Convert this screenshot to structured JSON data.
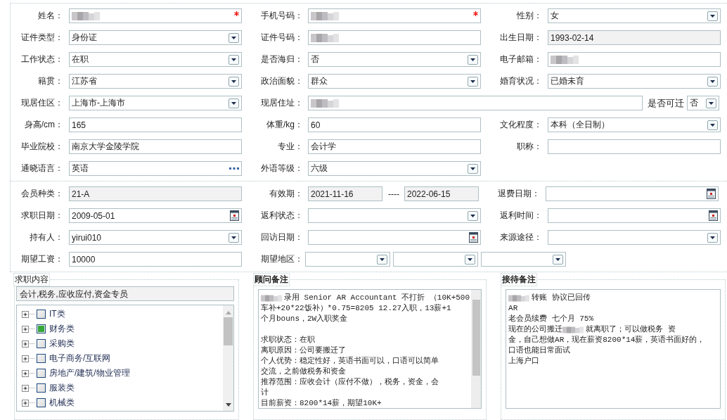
{
  "sections": [
    {
      "rows": [
        {
          "cells": [
            {
              "label": "姓名：",
              "kind": "text",
              "redacted": true,
              "required": true
            },
            {
              "label": "手机号码：",
              "kind": "text",
              "redacted": true,
              "required": true
            },
            {
              "label": "性别：",
              "kind": "select",
              "value": "女"
            }
          ]
        },
        {
          "cells": [
            {
              "label": "证件类型：",
              "kind": "select",
              "value": "身份证"
            },
            {
              "label": "证件号码：",
              "kind": "text",
              "redacted": true
            },
            {
              "label": "出生日期：",
              "kind": "text",
              "value": "1993-02-14",
              "disabled": true
            }
          ]
        },
        {
          "cells": [
            {
              "label": "工作状态：",
              "kind": "select",
              "value": "在职"
            },
            {
              "label": "是否海归：",
              "kind": "select",
              "value": "否"
            },
            {
              "label": "电子邮箱：",
              "kind": "text",
              "redacted": true
            }
          ]
        },
        {
          "cells": [
            {
              "label": "籍贯：",
              "kind": "select",
              "value": "江苏省"
            },
            {
              "label": "政治面貌：",
              "kind": "select",
              "value": "群众"
            },
            {
              "label": "婚育状况：",
              "kind": "select",
              "value": "已婚未育"
            }
          ]
        },
        {
          "cells": [
            {
              "label": "现居住区：",
              "kind": "select",
              "value": "上海市-上海市"
            },
            {
              "label": "现居住址：",
              "kind": "wide",
              "redacted": true,
              "extra": {
                "label": "是否可迁",
                "kind": "select",
                "value": "否"
              }
            }
          ]
        },
        {
          "cells": [
            {
              "label": "身高/cm：",
              "kind": "text",
              "value": "165"
            },
            {
              "label": "体重/kg：",
              "kind": "text",
              "value": "60"
            },
            {
              "label": "文化程度：",
              "kind": "select",
              "value": "本科（全日制）"
            }
          ]
        },
        {
          "cells": [
            {
              "label": "毕业院校：",
              "kind": "text",
              "value": "南京大学金陵学院"
            },
            {
              "label": "专业：",
              "kind": "text",
              "value": "会计学"
            },
            {
              "label": "职称：",
              "kind": "text"
            }
          ]
        },
        {
          "cells": [
            {
              "label": "通晓语言：",
              "kind": "lookup",
              "value": "英语"
            },
            {
              "label": "外语等级：",
              "kind": "select",
              "value": "六级"
            }
          ]
        }
      ]
    },
    {
      "rows": [
        {
          "cells": [
            {
              "label": "会员种类：",
              "kind": "text",
              "value": "21-A",
              "disabled": true
            },
            {
              "label": "有效期：",
              "kind": "range",
              "separator": "----",
              "parts": [
                {
                  "value": "2021-11-16",
                  "disabled": true
                },
                {
                  "value": "2022-06-15",
                  "disabled": true
                }
              ]
            },
            {
              "label": "退费日期：",
              "kind": "date"
            }
          ]
        },
        {
          "cells": [
            {
              "label": "求职日期：",
              "kind": "date",
              "value": "2009-05-01"
            },
            {
              "label": "返利状态：",
              "kind": "select"
            },
            {
              "label": "返利时间：",
              "kind": "date"
            }
          ]
        },
        {
          "cells": [
            {
              "label": "持有人：",
              "kind": "select",
              "value": "yirui010"
            },
            {
              "label": "回访日期：",
              "kind": "date"
            },
            {
              "label": "来源途径：",
              "kind": "select"
            }
          ]
        },
        {
          "cells": [
            {
              "label": "期望工资：",
              "kind": "text",
              "value": "10000"
            },
            {
              "label": "期望地区：",
              "kind": "multi",
              "parts": [
                {
                  "kind": "select"
                },
                {
                  "kind": "select"
                },
                {
                  "kind": "select"
                }
              ]
            }
          ]
        }
      ]
    }
  ],
  "panels": {
    "job": {
      "title": "求职内容",
      "summary": "会计,税务,应收应付,资金专员",
      "tree": [
        {
          "label": "IT类",
          "checked": false,
          "expanded": false
        },
        {
          "label": "财务类",
          "checked": true,
          "expanded": false
        },
        {
          "label": "采购类",
          "checked": false,
          "expanded": false
        },
        {
          "label": "电子商务/互联网",
          "checked": false,
          "expanded": false
        },
        {
          "label": "房地产/建筑/物业管理",
          "checked": false,
          "expanded": false
        },
        {
          "label": "服装类",
          "checked": false,
          "expanded": false
        },
        {
          "label": "机械类",
          "checked": false,
          "expanded": false
        }
      ]
    },
    "advisor": {
      "title": "顾问备注",
      "lines": [
        {
          "kind": "mixed",
          "parts": [
            {
              "kind": "blur"
            },
            {
              "kind": "text",
              "text": "录用 Senior AR Accountant 不打折 （10K+500"
            }
          ]
        },
        {
          "kind": "text",
          "text": "车补+20*22饭补）*0.75=8205  12.27入职，13薪+1"
        },
        {
          "kind": "text",
          "text": "个月bouns，2W入职奖金"
        },
        {
          "kind": "blank"
        },
        {
          "kind": "text",
          "text": "求职状态：在职"
        },
        {
          "kind": "text",
          "text": "离职原因：公司要搬迁了"
        },
        {
          "kind": "text",
          "text": "个人优势：稳定性好，英语书面可以，口语可以简单"
        },
        {
          "kind": "text",
          "text": "交流，之前做税务和资金"
        },
        {
          "kind": "text",
          "text": "推荐范围：应收会计（应付不做），税务，资金，会"
        },
        {
          "kind": "text",
          "text": "计"
        },
        {
          "kind": "text",
          "text": "目前薪资：8200*14薪，期望10K+"
        }
      ]
    },
    "reception": {
      "title": "接待备注",
      "lines": [
        {
          "kind": "mixed",
          "parts": [
            {
              "kind": "blur"
            },
            {
              "kind": "text",
              "text": "转账 协议已回传"
            }
          ]
        },
        {
          "kind": "text",
          "text": "AR"
        },
        {
          "kind": "text",
          "text": "老会员续费 七个月 75%"
        },
        {
          "kind": "mixed",
          "parts": [
            {
              "kind": "text",
              "text": "现在的公司搬迁"
            },
            {
              "kind": "blur"
            },
            {
              "kind": "text",
              "text": "就离职了；可以做税务 资"
            }
          ]
        },
        {
          "kind": "text",
          "text": "金，自己想做AR，现在薪资8200*14薪，英语书面好的，"
        },
        {
          "kind": "text",
          "text": "口语也能日常面试"
        },
        {
          "kind": "text",
          "text": "上海户口"
        }
      ]
    }
  }
}
